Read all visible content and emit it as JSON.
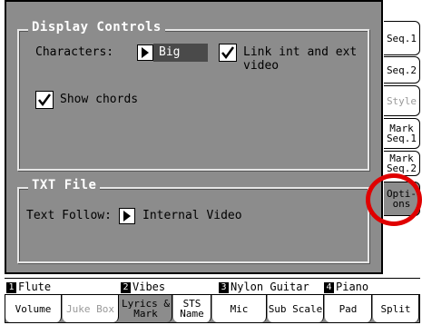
{
  "display_controls": {
    "title": "Display Controls",
    "characters_label": "Characters:",
    "characters_value": "Big",
    "link_label": "Link int and ext video",
    "link_checked": true,
    "show_chords_label": "Show chords",
    "show_chords_checked": true
  },
  "txt_file": {
    "title": "TXT File",
    "text_follow_label": "Text Follow:",
    "text_follow_value": "Internal Video"
  },
  "side_tabs": [
    {
      "label": "Seq.1",
      "state": "normal"
    },
    {
      "label": "Seq.2",
      "state": "normal"
    },
    {
      "label": "Style",
      "state": "disabled"
    },
    {
      "label": "Mark Seq.1",
      "state": "normal"
    },
    {
      "label": "Mark Seq.2",
      "state": "normal"
    },
    {
      "label": "Opti- ons",
      "state": "active"
    }
  ],
  "tracks": [
    {
      "num": "1",
      "name": "Flute"
    },
    {
      "num": "2",
      "name": "Vibes"
    },
    {
      "num": "3",
      "name": "Nylon Guitar"
    },
    {
      "num": "4",
      "name": "Piano"
    }
  ],
  "bottom_tabs": [
    {
      "label": "Volume",
      "state": "normal"
    },
    {
      "label": "Juke Box",
      "state": "disabled"
    },
    {
      "label": "Lyrics & Mark",
      "state": "active"
    },
    {
      "label": "STS Name",
      "state": "normal"
    },
    {
      "label": "Mic",
      "state": "normal"
    },
    {
      "label": "Sub Scale",
      "state": "normal"
    },
    {
      "label": "Pad",
      "state": "normal"
    },
    {
      "label": "Split",
      "state": "normal"
    }
  ],
  "highlight_color": "#e00000"
}
